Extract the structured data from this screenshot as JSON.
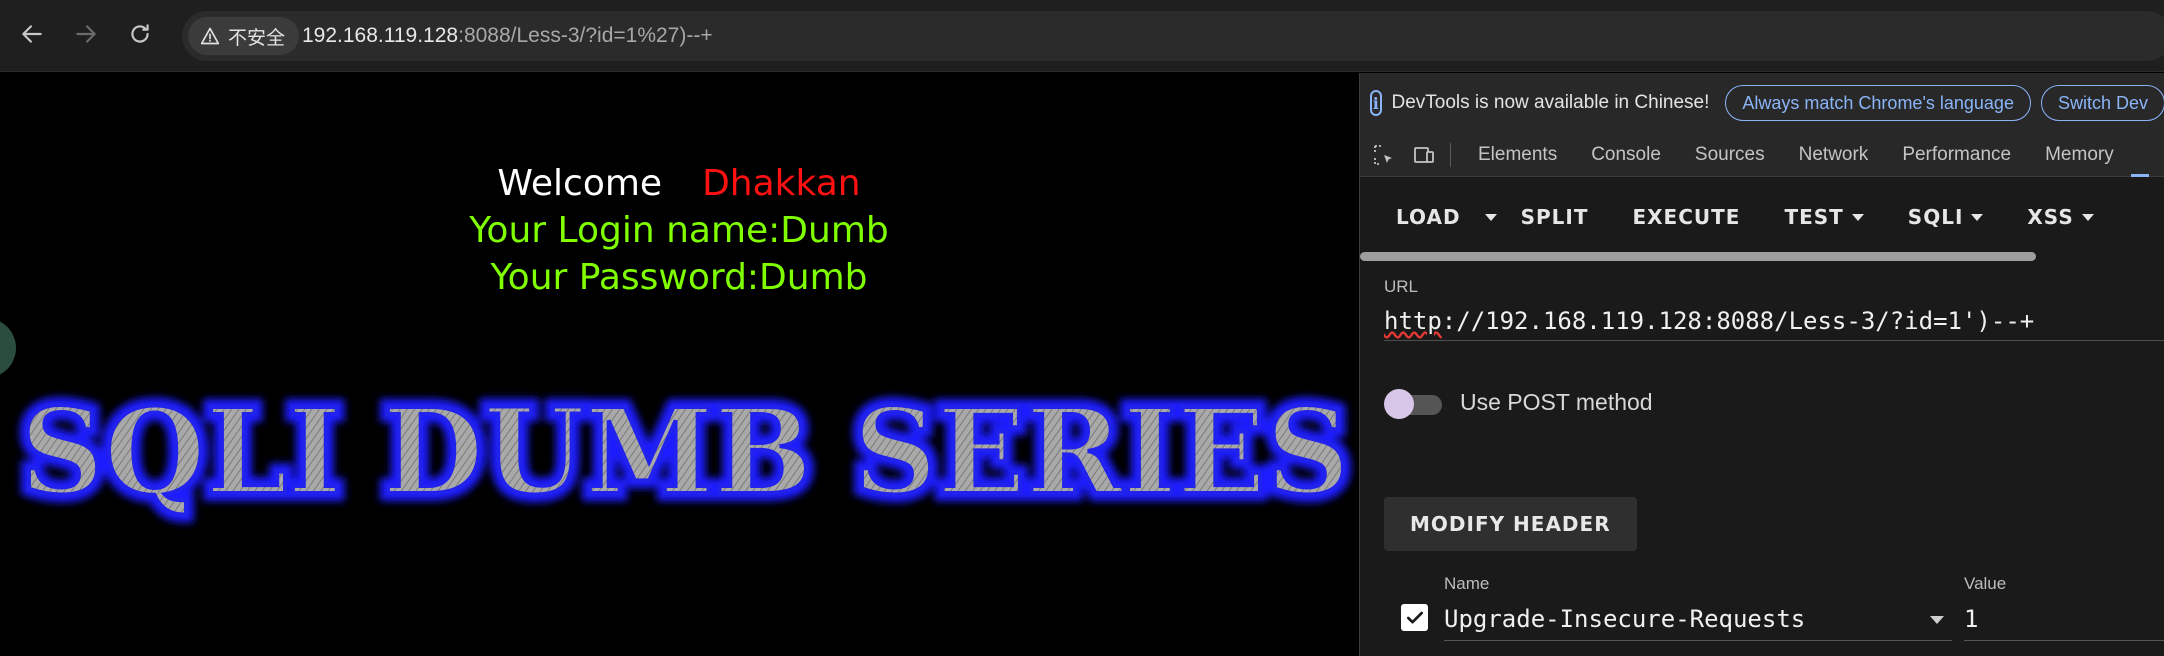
{
  "browser": {
    "security_label": "不安全",
    "url_host": "192.168.119.128",
    "url_rest": ":8088/Less-3/?id=1%27)--+"
  },
  "page": {
    "welcome_label": "Welcome",
    "welcome_name": "Dhakkan",
    "login_line": "Your Login name:Dumb",
    "password_line": "Your Password:Dumb",
    "banner_text": "SQLI DUMB SERIES"
  },
  "devtools": {
    "info_text": "DevTools is now available in Chinese!",
    "match_button": "Always match Chrome's language",
    "switch_button": "Switch Dev",
    "tabs": [
      "Elements",
      "Console",
      "Sources",
      "Network",
      "Performance",
      "Memory"
    ]
  },
  "hackbar": {
    "buttons": {
      "load": "LOAD",
      "split": "SPLIT",
      "execute": "EXECUTE",
      "test": "TEST",
      "sqli": "SQLI",
      "xss": "XSS"
    },
    "url_label": "URL",
    "url_scheme": "http",
    "url_rest": "://192.168.119.128:8088/Less-3/?id=1')--+",
    "post_label": "Use POST method",
    "modify_header": "MODIFY HEADER",
    "col_name": "Name",
    "col_value": "Value",
    "header_name": "Upgrade-Insecure-Requests",
    "header_value": "1"
  }
}
